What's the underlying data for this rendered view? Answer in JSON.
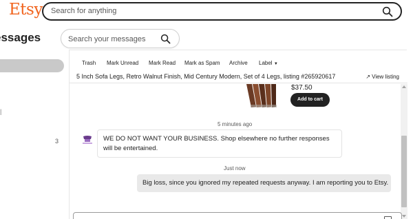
{
  "header": {
    "logo": "Etsy",
    "search_placeholder": "Search for anything"
  },
  "sidebar": {
    "title": "essages",
    "unread_count": "3"
  },
  "message_search": {
    "placeholder": "Search your messages"
  },
  "toolbar": {
    "items": [
      "Trash",
      "Mark Unread",
      "Mark Read",
      "Mark as Spam",
      "Archive",
      "Label"
    ]
  },
  "listing": {
    "title": "5 Inch Sofa Legs, Retro Walnut Finish, Mid Century Modern, Set of 4 Legs, listing #265920617",
    "view_link": "View listing",
    "price": "$37.50",
    "add_to_cart": "Add to cart"
  },
  "thread": {
    "messages": [
      {
        "timestamp": "5 minutes ago",
        "text": "WE DO NOT WANT YOUR BUSINESS. Shop elsewhere no further responses will be entertained."
      },
      {
        "timestamp": "Just now",
        "text": "Big loss, since you ignored my repeated requests anyway. I am reporting you to Etsy."
      }
    ]
  },
  "colors": {
    "brand": "#f1641e",
    "button_dark": "#222222",
    "bubble_self": "#e9e9e9"
  },
  "icons": [
    "search-icon",
    "chevron-down-icon",
    "external-link-icon",
    "shop-logo-avatar",
    "image-icon"
  ]
}
